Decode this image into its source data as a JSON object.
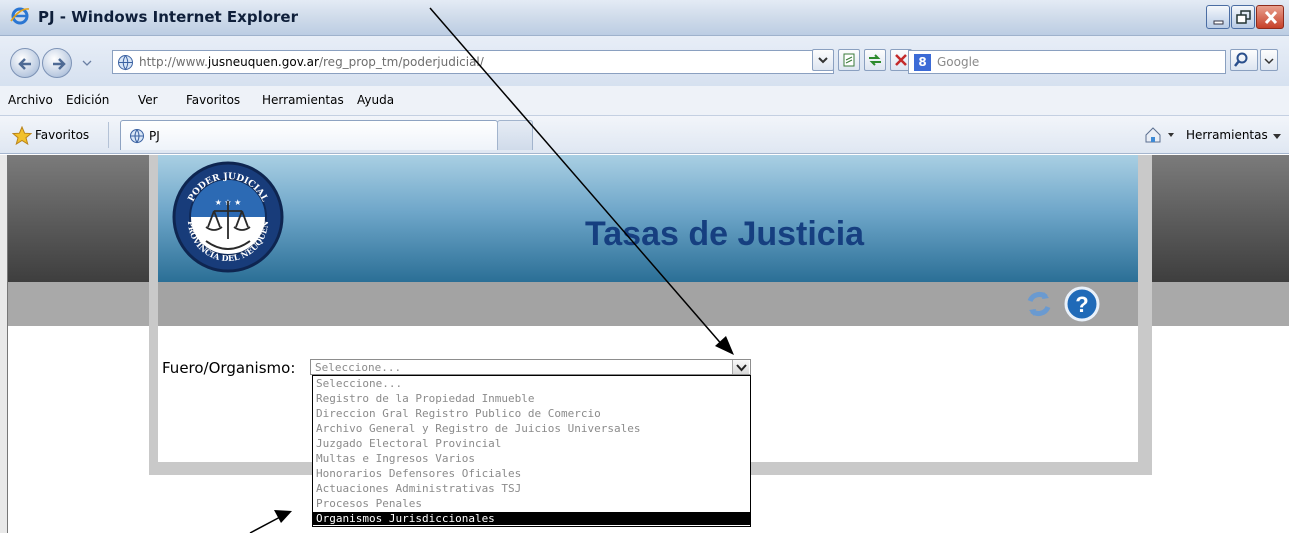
{
  "window": {
    "title": "PJ - Windows Internet Explorer"
  },
  "address": {
    "host_prefix": "http://www.",
    "host": "jusneuquen.gov.ar",
    "path": "/reg_prop_tm/poderjudicial/"
  },
  "search": {
    "placeholder": "Google",
    "logo": "8"
  },
  "menu": [
    "Archivo",
    "Edición",
    "Ver",
    "Favoritos",
    "Herramientas",
    "Ayuda"
  ],
  "favorites": {
    "label": "Favoritos",
    "tab_label": "PJ",
    "tools_label": "Herramientas"
  },
  "page": {
    "header_title": "Tasas de Justicia",
    "seal_top_text": "PODER JUDICIAL",
    "seal_bottom_text": "PROVINCIA DEL NEUQUEN",
    "form_label": "Fuero/Organismo:",
    "select_value": "Seleccione...",
    "options": [
      "Seleccione...",
      "Registro de la Propiedad Inmueble",
      "Direccion Gral Registro Publico de Comercio",
      "Archivo General y Registro de Juicios Universales",
      "Juzgado Electoral Provincial",
      "Multas e Ingresos Varios",
      "Honorarios Defensores Oficiales",
      "Actuaciones Administrativas TSJ",
      "Procesos Penales",
      "Organismos Jurisdiccionales"
    ],
    "selected_index": 9
  },
  "colors": {
    "header_title": "#163f80",
    "header_band": "#6ea6c9",
    "dark_band": "#3e3e3e",
    "gray_band": "#a3a3a3"
  }
}
